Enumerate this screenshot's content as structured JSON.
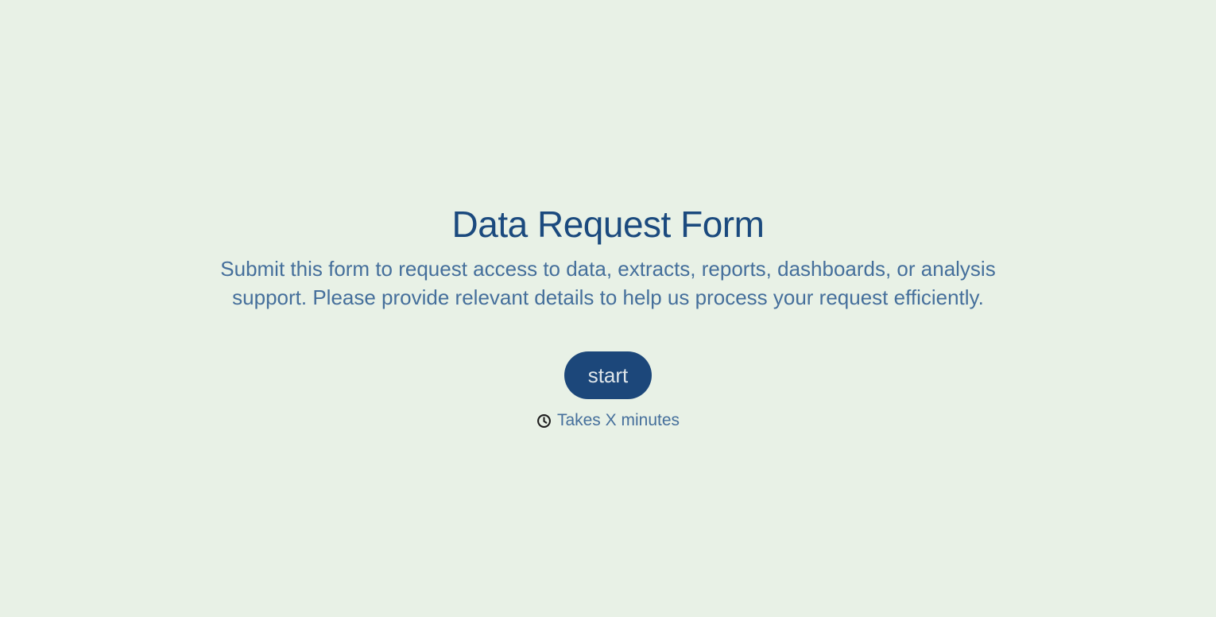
{
  "form": {
    "title": "Data Request Form",
    "description": "Submit this form to request access to data, extracts, reports, dashboards, or analysis support. Please provide relevant details to help us process your request efficiently.",
    "start_label": "start",
    "duration_icon": "clock-icon",
    "duration_text": "Takes X minutes"
  },
  "colors": {
    "background": "#e8f1e6",
    "title": "#1b4a7e",
    "body_text": "#456f9b",
    "button": "#1c477a",
    "button_text": "#dfe6ea"
  }
}
